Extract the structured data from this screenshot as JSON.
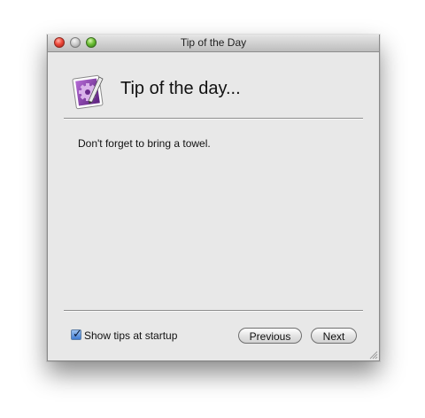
{
  "window": {
    "title": "Tip of the Day"
  },
  "header": {
    "heading": "Tip of the day...",
    "icon": "settings-pencil-icon"
  },
  "tip": {
    "text": "Don't forget to bring a towel."
  },
  "footer": {
    "show_tips_label": "Show tips at startup",
    "show_tips_checked": true,
    "previous_label": "Previous",
    "next_label": "Next"
  },
  "colors": {
    "icon_purple": "#7b3fa0",
    "checkbox_blue": "#3e7ad1"
  }
}
